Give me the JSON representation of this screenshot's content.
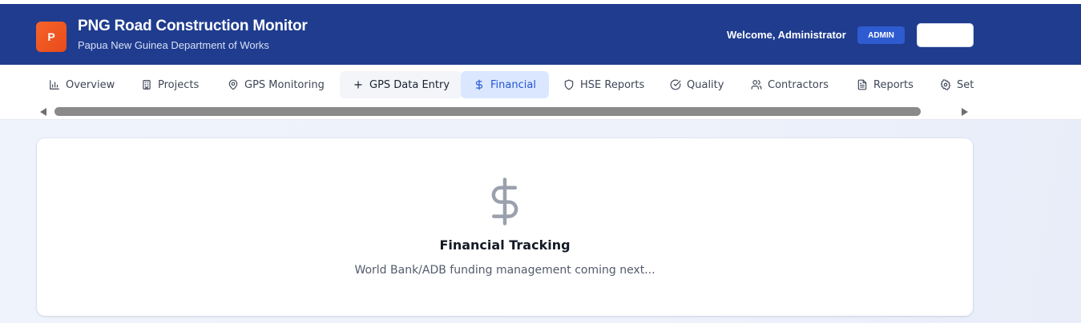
{
  "header": {
    "logo_letter": "P",
    "title": "PNG Road Construction Monitor",
    "subtitle": "Papua New Guinea Department of Works",
    "welcome": "Welcome, Administrator",
    "role_badge": "ADMIN"
  },
  "nav": {
    "tabs": [
      {
        "label": "Overview",
        "icon": "bar-chart-icon"
      },
      {
        "label": "Projects",
        "icon": "building-icon"
      },
      {
        "label": "GPS Monitoring",
        "icon": "map-pin-icon"
      },
      {
        "label": "GPS Data Entry",
        "icon": "plus-icon"
      },
      {
        "label": "Financial",
        "icon": "dollar-icon",
        "active": true
      },
      {
        "label": "HSE Reports",
        "icon": "shield-icon"
      },
      {
        "label": "Quality",
        "icon": "check-circle-icon"
      },
      {
        "label": "Contractors",
        "icon": "users-icon"
      },
      {
        "label": "Reports",
        "icon": "file-text-icon"
      },
      {
        "label": "Settings",
        "icon": "gear-icon"
      }
    ]
  },
  "main": {
    "icon": "dollar-icon",
    "title": "Financial Tracking",
    "text": "World Bank/ADB funding management coming next..."
  },
  "colors": {
    "header_bg": "#1f3c8f",
    "active_tab_bg": "#dbe7ff",
    "active_tab_text": "#2456d6",
    "logo_bg": "#f6642a",
    "badge_bg": "#2f5bd0"
  }
}
